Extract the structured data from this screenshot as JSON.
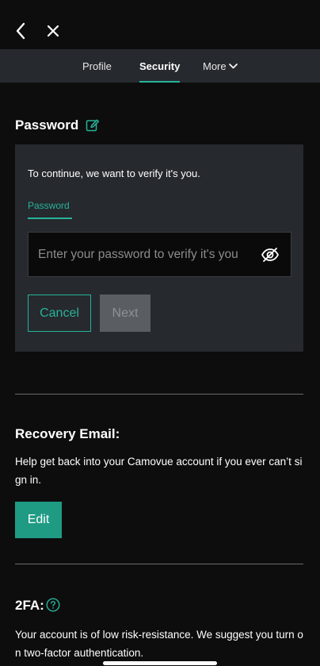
{
  "tabs": [
    {
      "label": "Profile"
    },
    {
      "label": "Security"
    },
    {
      "label": "More"
    }
  ],
  "password_section": {
    "title": "Password",
    "intro": "To continue, we want to verify it's you.",
    "field_label": "Password",
    "input_placeholder": "Enter your password to verify it's you",
    "input_value": "",
    "cancel_label": "Cancel",
    "next_label": "Next"
  },
  "recovery_section": {
    "title": "Recovery Email:",
    "description": "Help get back into your Camovue account if you ever can’t sign in.",
    "edit_label": "Edit"
  },
  "twofa_section": {
    "title": "2FA:",
    "description": "Your account is of low risk-resistance. We suggest you turn on two-factor authentication."
  },
  "colors": {
    "accent": "#27b39a",
    "button_fill": "#1f9b84",
    "card_bg": "#26292e",
    "tabbar_bg": "#262a2f",
    "page_bg": "#0d0d0d"
  },
  "icons": {
    "back": "chevron-left-icon",
    "close": "close-icon",
    "more": "chevron-down-icon",
    "edit": "edit-pencil-icon",
    "visibility": "eye-off-icon",
    "help": "question-circle-icon"
  }
}
